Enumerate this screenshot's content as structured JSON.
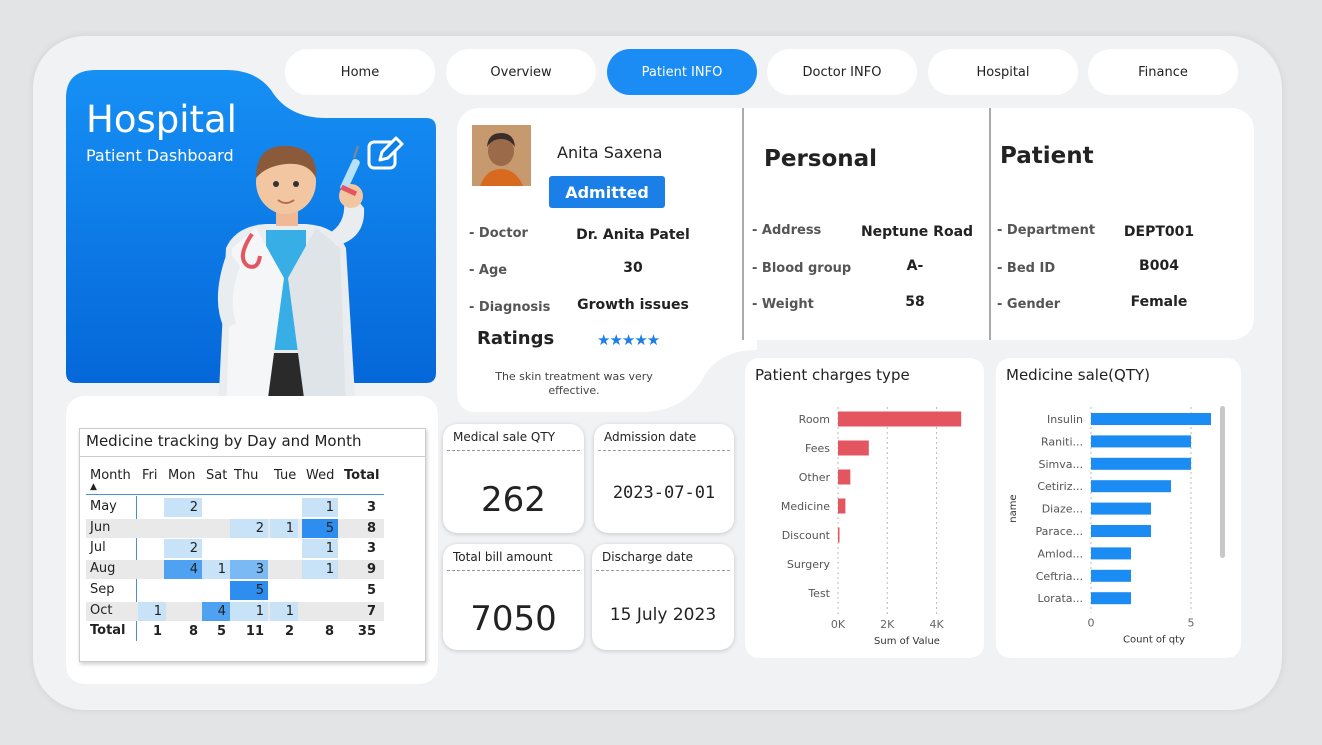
{
  "nav": [
    {
      "label": "Home",
      "active": false
    },
    {
      "label": "Overview",
      "active": false
    },
    {
      "label": "Patient INFO",
      "active": true
    },
    {
      "label": "Doctor INFO",
      "active": false
    },
    {
      "label": "Hospital",
      "active": false
    },
    {
      "label": "Finance",
      "active": false
    }
  ],
  "hero": {
    "title": "Hospital",
    "subtitle": "Patient Dashboard",
    "accent": "#0a7fe6"
  },
  "patient": {
    "name": "Anita Saxena",
    "status": "Admitted",
    "doctor_label": "- Doctor",
    "doctor": "Dr. Anita Patel",
    "age_label": "- Age",
    "age": "30",
    "diagnosis_label": "- Diagnosis",
    "diagnosis": "Growth issues",
    "ratings_label": "Ratings",
    "rating_stars": "★★★★★",
    "rating_value": 5,
    "review": "The skin treatment was very effective."
  },
  "personal": {
    "heading": "Personal",
    "address_label": "- Address",
    "address": "Neptune Road",
    "blood_label": "- Blood group",
    "blood": "A-",
    "weight_label": "- Weight",
    "weight": "58"
  },
  "patient_info": {
    "heading": "Patient",
    "department_label": "- Department",
    "department": "DEPT001",
    "bed_label": "- Bed ID",
    "bed": "B004",
    "gender_label": "- Gender",
    "gender": "Female"
  },
  "kpis": {
    "medical_sale_label": "Medical sale QTY",
    "medical_sale": "262",
    "admission_label": "Admission date",
    "admission": "2023-07-01",
    "bill_label": "Total bill amount",
    "bill": "7050",
    "discharge_label": "Discharge date",
    "discharge": "15 July 2023"
  },
  "matrix": {
    "title": "Medicine tracking by Day and Month",
    "columns": [
      "Month",
      "Fri",
      "Mon",
      "Sat",
      "Thu",
      "Tue",
      "Wed",
      "Total"
    ],
    "rows": [
      {
        "month": "May",
        "cells": [
          "",
          "2",
          "",
          "",
          "",
          "1"
        ],
        "total": "3"
      },
      {
        "month": "Jun",
        "cells": [
          "",
          "",
          "",
          "2",
          "1",
          "5"
        ],
        "total": "8"
      },
      {
        "month": "Jul",
        "cells": [
          "",
          "2",
          "",
          "",
          "",
          "1"
        ],
        "total": "3"
      },
      {
        "month": "Aug",
        "cells": [
          "",
          "4",
          "1",
          "3",
          "",
          "1"
        ],
        "total": "9"
      },
      {
        "month": "Sep",
        "cells": [
          "",
          "",
          "",
          "5",
          "",
          ""
        ],
        "total": "5"
      },
      {
        "month": "Oct",
        "cells": [
          "1",
          "",
          "4",
          "1",
          "1",
          ""
        ],
        "total": "7"
      }
    ],
    "total_row": {
      "label": "Total",
      "cells": [
        "1",
        "8",
        "5",
        "11",
        "2",
        "8"
      ],
      "total": "35"
    }
  },
  "chart_data": [
    {
      "type": "bar",
      "orientation": "horizontal",
      "title": "Patient charges type",
      "categories": [
        "Room",
        "Fees",
        "Other",
        "Medicine",
        "Discount",
        "Surgery",
        "Test"
      ],
      "values": [
        5000,
        1250,
        500,
        300,
        50,
        0,
        0
      ],
      "xlabel": "Sum of Value",
      "ylabel": "",
      "xlim": [
        0,
        5600
      ],
      "xticks": [
        "0K",
        "2K",
        "4K"
      ],
      "xtick_values": [
        0,
        2000,
        4000
      ],
      "color": "#e3565f"
    },
    {
      "type": "bar",
      "orientation": "horizontal",
      "title": "Medicine sale(QTY)",
      "categories": [
        "Insulin",
        "Raniti...",
        "Simva...",
        "Cetiriz...",
        "Diaze...",
        "Parace...",
        "Amlod...",
        "Ceftria...",
        "Lorata..."
      ],
      "values": [
        6,
        5,
        5,
        4,
        3,
        3,
        2,
        2,
        2
      ],
      "xlabel": "Count of qty",
      "ylabel": "name",
      "xlim": [
        0,
        6.3
      ],
      "xticks": [
        "0",
        "5"
      ],
      "xtick_values": [
        0,
        5
      ],
      "color": "#1a8cf4"
    }
  ]
}
